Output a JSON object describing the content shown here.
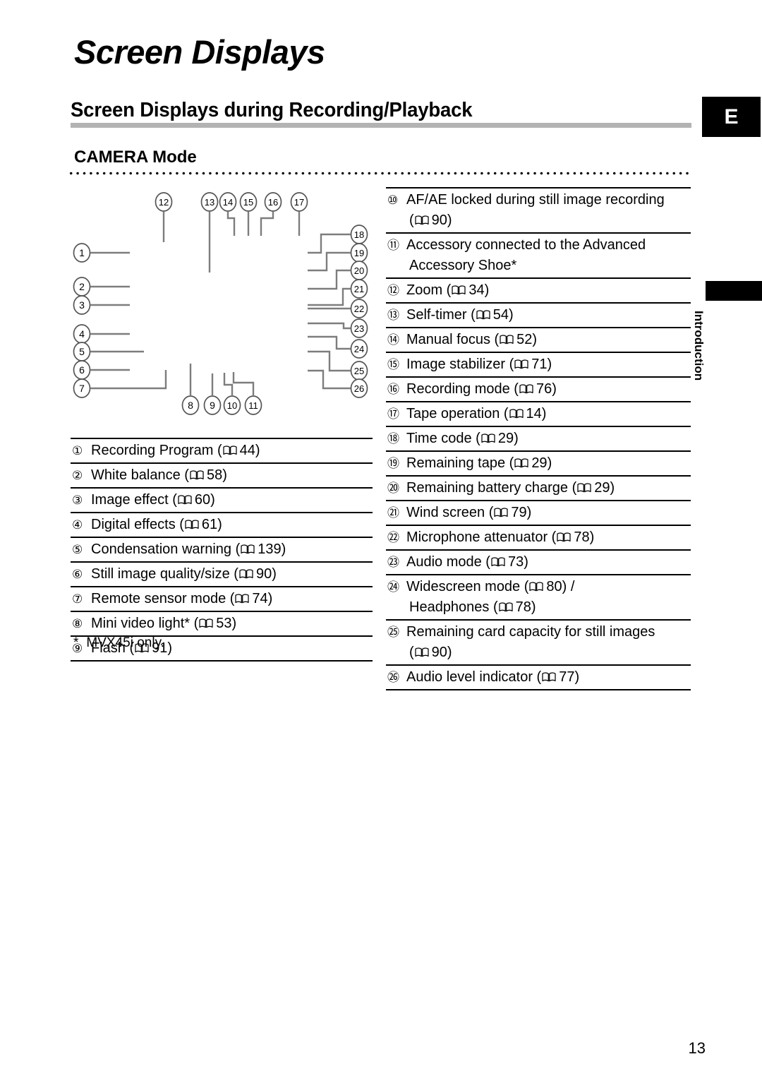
{
  "page": {
    "title": "Screen Displays",
    "section_heading": "Screen Displays during Recording/Playback",
    "subsection_title": "CAMERA Mode",
    "language_badge": "E",
    "side_tab_label": "Introduction",
    "footnote": "MVX45i only.",
    "footnote_marker": "*",
    "page_number": "13"
  },
  "diagram": {
    "name": "camera-mode-screen-display-callout-diagram",
    "callout_numbers_top": [
      "12",
      "13",
      "14",
      "15",
      "16",
      "17"
    ],
    "callout_numbers_left": [
      "1",
      "2",
      "3",
      "4",
      "5",
      "6",
      "7"
    ],
    "callout_numbers_bottom": [
      "8",
      "9",
      "10",
      "11"
    ],
    "callout_numbers_right": [
      "18",
      "19",
      "20",
      "21",
      "22",
      "23",
      "24",
      "25",
      "26"
    ]
  },
  "list_left": [
    {
      "num": "1",
      "lines": [
        {
          "text": "Recording Program (",
          "book": true,
          "page": "44",
          "tail": ")"
        }
      ]
    },
    {
      "num": "2",
      "lines": [
        {
          "text": "White balance (",
          "book": true,
          "page": "58",
          "tail": ")"
        }
      ]
    },
    {
      "num": "3",
      "lines": [
        {
          "text": "Image effect (",
          "book": true,
          "page": "60",
          "tail": ")"
        }
      ]
    },
    {
      "num": "4",
      "lines": [
        {
          "text": "Digital effects (",
          "book": true,
          "page": "61",
          "tail": ")"
        }
      ]
    },
    {
      "num": "5",
      "lines": [
        {
          "text": "Condensation warning (",
          "book": true,
          "page": "139",
          "tail": ")"
        }
      ]
    },
    {
      "num": "6",
      "lines": [
        {
          "text": "Still image quality/size (",
          "book": true,
          "page": "90",
          "tail": ")"
        }
      ]
    },
    {
      "num": "7",
      "lines": [
        {
          "text": "Remote sensor mode (",
          "book": true,
          "page": "74",
          "tail": ")"
        }
      ]
    },
    {
      "num": "8",
      "lines": [
        {
          "text": "Mini video light* (",
          "book": true,
          "page": "53",
          "tail": ")"
        }
      ]
    },
    {
      "num": "9",
      "lines": [
        {
          "text": "Flash (",
          "book": true,
          "page": "91",
          "tail": ")"
        }
      ]
    }
  ],
  "list_right": [
    {
      "num": "10",
      "lines": [
        {
          "text": "AF/AE locked during still image recording",
          "book": false,
          "page": "",
          "tail": ""
        },
        {
          "text": "(",
          "book": true,
          "page": "90",
          "tail": ")",
          "cont": true
        }
      ]
    },
    {
      "num": "11",
      "lines": [
        {
          "text": "Accessory connected to the Advanced",
          "book": false,
          "page": "",
          "tail": ""
        },
        {
          "text": "Accessory Shoe*",
          "book": false,
          "page": "",
          "tail": "",
          "cont": true
        }
      ]
    },
    {
      "num": "12",
      "lines": [
        {
          "text": "Zoom (",
          "book": true,
          "page": "34",
          "tail": ")"
        }
      ]
    },
    {
      "num": "13",
      "lines": [
        {
          "text": "Self-timer (",
          "book": true,
          "page": "54",
          "tail": ")"
        }
      ]
    },
    {
      "num": "14",
      "lines": [
        {
          "text": "Manual focus (",
          "book": true,
          "page": "52",
          "tail": ")"
        }
      ]
    },
    {
      "num": "15",
      "lines": [
        {
          "text": "Image stabilizer (",
          "book": true,
          "page": "71",
          "tail": ")"
        }
      ]
    },
    {
      "num": "16",
      "lines": [
        {
          "text": "Recording mode (",
          "book": true,
          "page": "76",
          "tail": ")"
        }
      ]
    },
    {
      "num": "17",
      "lines": [
        {
          "text": "Tape operation (",
          "book": true,
          "page": "14",
          "tail": ")"
        }
      ]
    },
    {
      "num": "18",
      "lines": [
        {
          "text": "Time code (",
          "book": true,
          "page": "29",
          "tail": ")"
        }
      ]
    },
    {
      "num": "19",
      "lines": [
        {
          "text": "Remaining tape (",
          "book": true,
          "page": "29",
          "tail": ")"
        }
      ]
    },
    {
      "num": "20",
      "lines": [
        {
          "text": "Remaining battery charge (",
          "book": true,
          "page": "29",
          "tail": ")"
        }
      ]
    },
    {
      "num": "21",
      "lines": [
        {
          "text": "Wind screen (",
          "book": true,
          "page": "79",
          "tail": ")"
        }
      ]
    },
    {
      "num": "22",
      "lines": [
        {
          "text": "Microphone attenuator (",
          "book": true,
          "page": "78",
          "tail": ")"
        }
      ]
    },
    {
      "num": "23",
      "lines": [
        {
          "text": "Audio mode (",
          "book": true,
          "page": "73",
          "tail": ")"
        }
      ]
    },
    {
      "num": "24",
      "lines": [
        {
          "text": "Widescreen mode (",
          "book": true,
          "page": "80",
          "tail": ") /"
        },
        {
          "text": "Headphones (",
          "book": true,
          "page": "78",
          "tail": ")",
          "cont": true
        }
      ]
    },
    {
      "num": "25",
      "lines": [
        {
          "text": "Remaining card capacity for still images",
          "book": false,
          "page": "",
          "tail": ""
        },
        {
          "text": "(",
          "book": true,
          "page": "90",
          "tail": ")",
          "cont": true
        }
      ]
    },
    {
      "num": "26",
      "lines": [
        {
          "text": "Audio level indicator (",
          "book": true,
          "page": "77",
          "tail": ")"
        }
      ]
    }
  ],
  "colors": {
    "rule_gray": "#b3b3b3",
    "badge_black": "#000000",
    "leader_gray": "#808080"
  }
}
